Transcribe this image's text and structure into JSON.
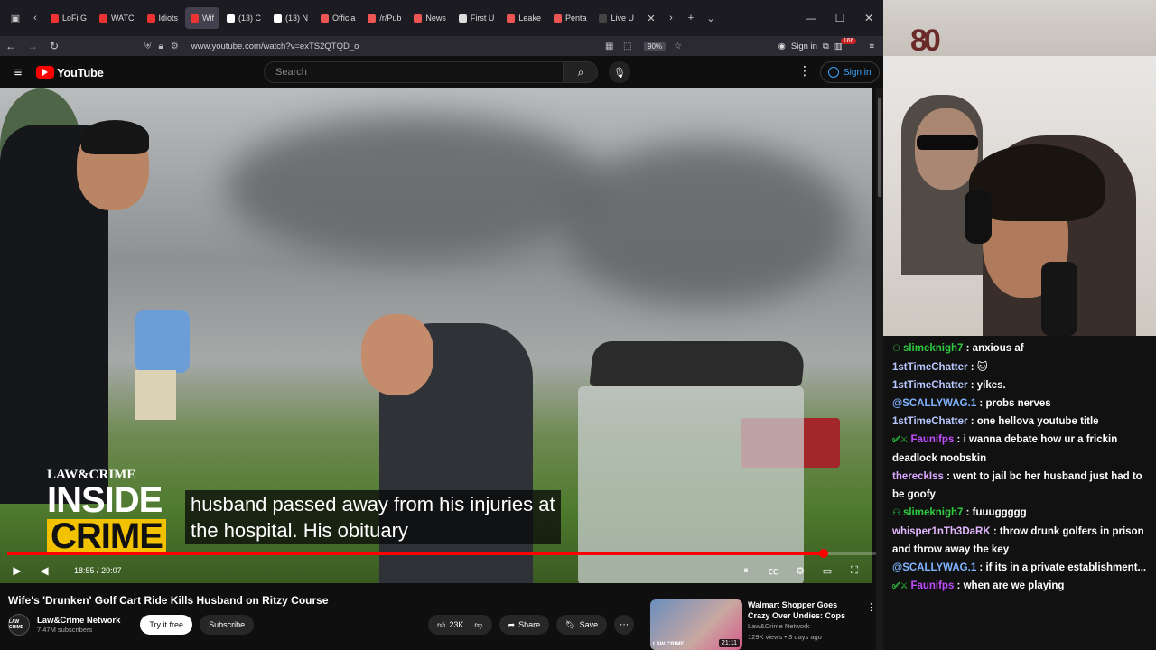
{
  "browser": {
    "tabs": [
      {
        "label": "LoFi G",
        "color": "#e33"
      },
      {
        "label": "WATC",
        "color": "#e33"
      },
      {
        "label": "Idiots",
        "color": "#e33"
      },
      {
        "label": "Wif",
        "color": "#e33",
        "active": true
      },
      {
        "label": "(13) C",
        "color": "#fff"
      },
      {
        "label": "(13) N",
        "color": "#fff"
      },
      {
        "label": "Officia",
        "color": "#e55"
      },
      {
        "label": "/r/Pub",
        "color": "#e55"
      },
      {
        "label": "News",
        "color": "#e55"
      },
      {
        "label": "First U",
        "color": "#ddd"
      },
      {
        "label": "Leake",
        "color": "#e55"
      },
      {
        "label": "Penta",
        "color": "#e55"
      },
      {
        "label": "Live U",
        "color": "#444"
      }
    ],
    "url": "www.youtube.com/watch?v=exTS2QTQD_o",
    "zoom": "90%",
    "sign_in": "Sign in",
    "notif_count": "166"
  },
  "youtube": {
    "logo_text": "YouTube",
    "search_placeholder": "Search",
    "sign_in": "Sign in",
    "video": {
      "brand_top": "LAW&CRIME",
      "brand_inside": "INSIDE",
      "brand_crime": "CRIME",
      "caption_line1": "husband passed away from his injuries at",
      "caption_line2": "the hospital. His obituary",
      "current_time": "18:55",
      "duration": "20:07",
      "progress": 0.94
    },
    "title": "Wife's 'Drunken' Golf Cart Ride Kills Husband on Ritzy Course",
    "channel": {
      "name": "Law&Crime Network",
      "subscribers": "7.47M subscribers",
      "avatar_text": "LAW CRIME",
      "try_free": "Try it free",
      "subscribe": "Subscribe"
    },
    "actions": {
      "likes": "23K",
      "share": "Share",
      "save": "Save"
    },
    "recommendation": {
      "title": "Walmart Shopper Goes Crazy Over Undies: Cops",
      "channel": "Law&Crime Network",
      "meta": "129K views • 3 days ago",
      "duration": "21:11",
      "thumb_logo": "LAW CRIME"
    }
  },
  "webcam": {
    "logo": "80"
  },
  "chat": [
    {
      "user": "slimeknigh7",
      "color": "#2ecc40",
      "text": "anxious af",
      "badge": "person"
    },
    {
      "user": "1stTimeChatter",
      "color": "#b8c7ff",
      "text": "🐱",
      "badge": ""
    },
    {
      "user": "1stTimeChatter",
      "color": "#b8c7ff",
      "text": "yikes.",
      "badge": ""
    },
    {
      "user": "@SCALLYWAG.1",
      "color": "#7fb3ff",
      "text": "probs nerves",
      "badge": ""
    },
    {
      "user": "1stTimeChatter",
      "color": "#b8c7ff",
      "text": "one hellova youtube title",
      "badge": ""
    },
    {
      "user": "Faunifps",
      "color": "#c04cff",
      "text": "i wanna debate how ur a frickin deadlock noobskin",
      "badge": "check"
    },
    {
      "user": "thereckIss",
      "color": "#d9a8ff",
      "text": "went to jail bc her husband just had to be goofy",
      "badge": ""
    },
    {
      "user": "slimeknigh7",
      "color": "#2ecc40",
      "text": "fuuuggggg",
      "badge": "person"
    },
    {
      "user": "whisper1nTh3DaRK",
      "color": "#e3b8ff",
      "text": "throw drunk golfers in prison and throw away the key",
      "badge": ""
    },
    {
      "user": "@SCALLYWAG.1",
      "color": "#7fb3ff",
      "text": "if its in a private establishment...",
      "badge": ""
    },
    {
      "user": "Faunifps",
      "color": "#c04cff",
      "text": "when are we playing",
      "badge": "check"
    }
  ]
}
